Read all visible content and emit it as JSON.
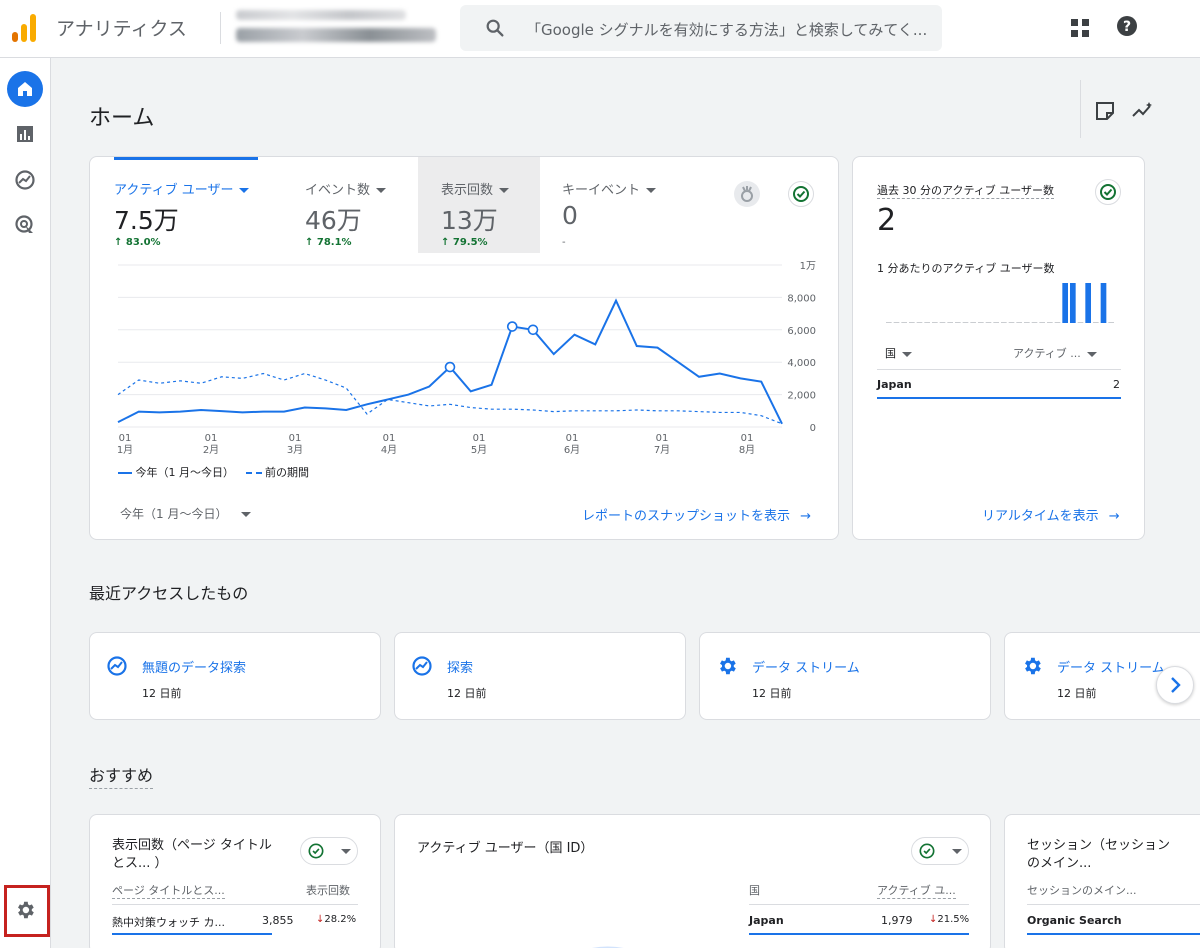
{
  "header": {
    "app_title": "アナリティクス",
    "search_placeholder": "「Google シグナルを有効にする方法」と検索してみてく..."
  },
  "home": {
    "page_title": "ホーム",
    "metrics": [
      {
        "label": "アクティブ ユーザー",
        "value": "7.5万",
        "change": "83.0%"
      },
      {
        "label": "イベント数",
        "value": "46万",
        "change": "78.1%"
      },
      {
        "label": "表示回数",
        "value": "13万",
        "change": "79.5%"
      },
      {
        "label": "キーイベント",
        "value": "0",
        "change": "-"
      }
    ],
    "legend_current": "今年（1 月～今日）",
    "legend_previous": "前の期間",
    "date_range": "今年（1 月～今日）",
    "snapshot_link": "レポートのスナップショットを表示"
  },
  "chart_data": {
    "type": "line",
    "y_ticks": [
      "1万",
      "8,000",
      "6,000",
      "4,000",
      "2,000",
      "0"
    ],
    "x_ticks": [
      {
        "day": "01",
        "month": "1月"
      },
      {
        "day": "01",
        "month": "2月"
      },
      {
        "day": "01",
        "month": "3月"
      },
      {
        "day": "01",
        "month": "4月"
      },
      {
        "day": "01",
        "month": "5月"
      },
      {
        "day": "01",
        "month": "6月"
      },
      {
        "day": "01",
        "month": "7月"
      },
      {
        "day": "01",
        "month": "8月"
      }
    ],
    "ylim": [
      0,
      10000
    ],
    "series": [
      {
        "name": "今年（1 月～今日）",
        "style": "solid",
        "color": "#1a73e8",
        "values": [
          300,
          950,
          900,
          950,
          1050,
          980,
          900,
          950,
          950,
          1200,
          1150,
          1050,
          1400,
          1700,
          2000,
          2500,
          3700,
          2200,
          2600,
          6200,
          6000,
          4500,
          5700,
          5100,
          7800,
          5000,
          4900,
          4000,
          3100,
          3300,
          3000,
          2800,
          200
        ]
      },
      {
        "name": "前の期間",
        "style": "dashed",
        "color": "#1a73e8",
        "values": [
          2000,
          2900,
          2700,
          2850,
          2700,
          3100,
          3000,
          3300,
          2900,
          3300,
          2900,
          2400,
          800,
          1700,
          1500,
          1300,
          1400,
          1200,
          1100,
          1100,
          1050,
          950,
          1000,
          1000,
          1000,
          1050,
          1000,
          1000,
          950,
          900,
          900,
          700,
          200
        ]
      }
    ],
    "highlighted_points": [
      16,
      19,
      20
    ]
  },
  "realtime": {
    "title": "過去 30 分のアクティブ ユーザー数",
    "value": "2",
    "per_minute_label": "1 分あたりのアクティブ ユーザー数",
    "bars": [
      0,
      0,
      0,
      0,
      0,
      0,
      0,
      0,
      0,
      0,
      0,
      0,
      0,
      0,
      0,
      0,
      0,
      0,
      0,
      0,
      0,
      0,
      0,
      1,
      1,
      0,
      1,
      0,
      1,
      0
    ],
    "col_country": "国",
    "col_users": "アクティブ ...",
    "rows": [
      {
        "country": "Japan",
        "users": "2"
      }
    ],
    "link": "リアルタイムを表示"
  },
  "recent": {
    "title": "最近アクセスしたもの",
    "items": [
      {
        "name": "無題のデータ探索",
        "time": "12 日前",
        "icon": "explore-icon"
      },
      {
        "name": "探索",
        "time": "12 日前",
        "icon": "explore-icon"
      },
      {
        "name": "データ ストリーム",
        "time": "12 日前",
        "icon": "gear-icon"
      },
      {
        "name": "データ ストリーム",
        "time": "12 日前",
        "icon": "gear-icon"
      }
    ]
  },
  "recommended": {
    "title": "おすすめ",
    "cards": [
      {
        "title": "表示回数（ページ タイトルとス... ）",
        "col1": "ページ タイトルとス...",
        "col2": "表示回数",
        "rows": [
          {
            "name": "熱中対策ウォッチ カ...",
            "value": "3,855",
            "change": "28.2%"
          }
        ]
      },
      {
        "title": "アクティブ ユーザー（国 ID）",
        "col1": "国",
        "col2": "アクティブ ユ...",
        "rows": [
          {
            "name": "Japan",
            "value": "1,979",
            "change": "21.5%"
          }
        ]
      },
      {
        "title": "セッション（セッションのメイン...",
        "col1": "セッションのメイン...",
        "col2": "",
        "rows": [
          {
            "name": "Organic Search",
            "value": "",
            "change": ""
          }
        ]
      }
    ]
  }
}
